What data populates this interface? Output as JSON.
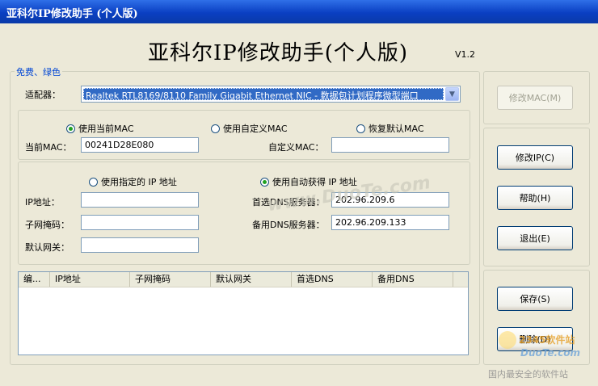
{
  "window": {
    "title": "亚科尔IP修改助手 (个人版)"
  },
  "header": {
    "title": "亚科尔IP修改助手(个人版)",
    "version": "V1.2"
  },
  "group_label": "免费、绿色",
  "adapter": {
    "label": "适配器：",
    "value": "Realtek RTL8169/8110 Family Gigabit Ethernet NIC - 数据包计划程序微型端口"
  },
  "mac": {
    "radio_current": "使用当前MAC",
    "radio_custom": "使用自定义MAC",
    "radio_default": "恢复默认MAC",
    "current_label": "当前MAC：",
    "current_value": "00241D28E080",
    "custom_label": "自定义MAC：",
    "custom_value": ""
  },
  "ip": {
    "radio_manual": "使用指定的 IP 地址",
    "radio_auto": "使用自动获得 IP 地址",
    "ip_label": "IP地址：",
    "ip_value": "",
    "mask_label": "子网掩码：",
    "mask_value": "",
    "gateway_label": "默认网关：",
    "gateway_value": "",
    "dns1_label": "首选DNS服务器：",
    "dns1_value": "202.96.209.6",
    "dns2_label": "备用DNS服务器：",
    "dns2_value": "202.96.209.133"
  },
  "table": {
    "columns": [
      "编...",
      "IP地址",
      "子网掩码",
      "默认网关",
      "首选DNS",
      "备用DNS"
    ]
  },
  "buttons": {
    "modify_mac": "修改MAC(M)",
    "modify_ip": "修改IP(C)",
    "help": "帮助(H)",
    "exit": "退出(E)",
    "save": "保存(S)",
    "delete": "删除(D)"
  },
  "watermarks": {
    "center": "www.DuoTe.com",
    "corner_top": "2345软件站",
    "corner_site": "DuoTe.com",
    "corner_bottom": "国内最安全的软件站"
  }
}
